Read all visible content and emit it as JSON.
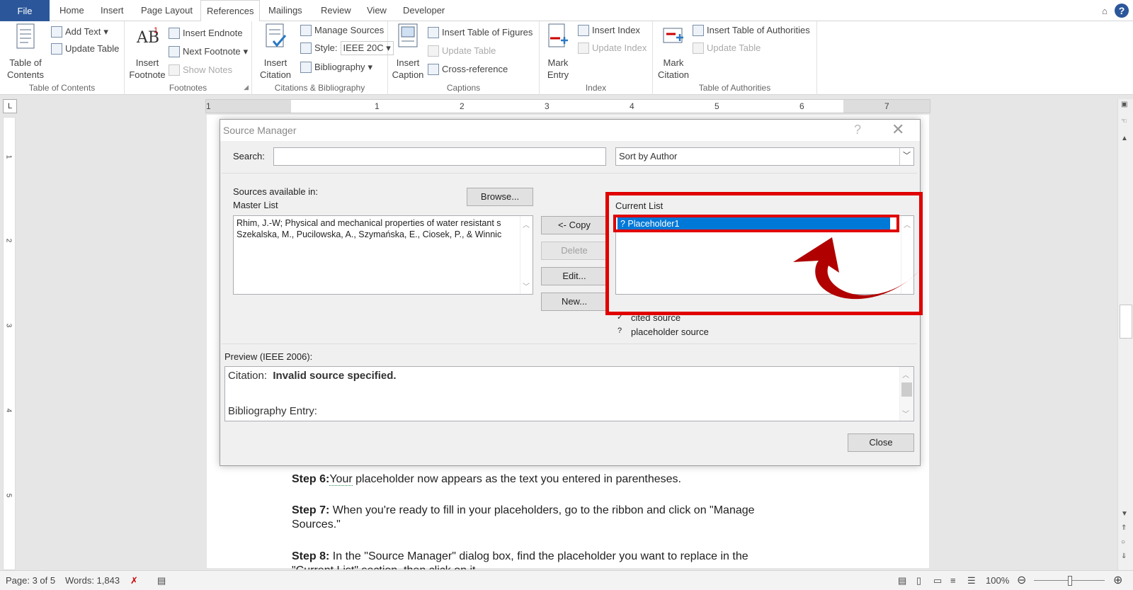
{
  "tabs": {
    "file": "File",
    "items": [
      "Home",
      "Insert",
      "Page Layout",
      "References",
      "Mailings",
      "Review",
      "View",
      "Developer"
    ],
    "active": "References"
  },
  "ribbon": {
    "toc": {
      "big_label": "Table of Contents",
      "add_text": "Add Text",
      "update_table": "Update Table",
      "group": "Table of Contents"
    },
    "footnotes": {
      "big_label": "Insert Footnote",
      "insert_endnote": "Insert Endnote",
      "next_footnote": "Next Footnote",
      "show_notes": "Show Notes",
      "group": "Footnotes"
    },
    "citations": {
      "big_label": "Insert Citation",
      "manage_sources": "Manage Sources",
      "style_label": "Style:",
      "style_value": "IEEE 20C",
      "bibliography": "Bibliography",
      "group": "Citations & Bibliography"
    },
    "captions": {
      "big_label": "Insert Caption",
      "insert_tof": "Insert Table of Figures",
      "update_table": "Update Table",
      "cross_ref": "Cross-reference",
      "group": "Captions"
    },
    "index": {
      "big_label": "Mark Entry",
      "insert_index": "Insert Index",
      "update_index": "Update Index",
      "group": "Index"
    },
    "authorities": {
      "big_label": "Mark Citation",
      "insert_toa": "Insert Table of Authorities",
      "update_table": "Update Table",
      "group": "Table of Authorities"
    }
  },
  "ruler": {
    "corner": "L",
    "h_numbers": [
      "1",
      "1",
      "2",
      "3",
      "4",
      "5",
      "6",
      "7"
    ],
    "v_numbers": [
      "1",
      "2",
      "3",
      "4",
      "5"
    ]
  },
  "dialog": {
    "title": "Source Manager",
    "help": "?",
    "close_x": "✕",
    "search_label": "Search:",
    "search_value": "",
    "sort_value": "Sort by Author",
    "sources_label": "Sources available in:",
    "master_list_label": "Master List",
    "browse": "Browse...",
    "master_items": [
      "Rhim, J.-W; Physical and mechanical properties of water resistant s",
      "Szekalska, M., Pucilowska, A., Szymańska, E., Ciosek, P., & Winnic"
    ],
    "copy": "<- Copy",
    "delete": "Delete",
    "edit": "Edit...",
    "new": "New...",
    "current_list_label": "Current List",
    "current_items": [
      "? Placeholder1"
    ],
    "legend": [
      {
        "mark": "✓",
        "text": "cited source"
      },
      {
        "mark": "?",
        "text": "placeholder source"
      }
    ],
    "preview_label": "Preview (IEEE 2006):",
    "citation_prefix": "Citation:",
    "citation_text": "Invalid source specified.",
    "bibliography_label": "Bibliography Entry:",
    "close": "Close"
  },
  "document": {
    "step6_label": "Step 6:",
    "step6_word": "Your",
    "step6_rest": " placeholder now appears as the text you entered in parentheses.",
    "step7_label": "Step 7:",
    "step7_line1": " When you're ready to fill in your placeholders, go to the ribbon and click on \"Manage",
    "step7_line2": "Sources.\"",
    "step8_label": "Step 8:",
    "step8_line1": " In the \"Source Manager\" dialog box, find the placeholder you want to replace in the",
    "step8_line2": "\"Current List\" section, then click on it."
  },
  "status": {
    "page": "Page: 3 of 5",
    "words": "Words: 1,843",
    "zoom": "100%"
  },
  "colors": {
    "file_tab": "#2b579a",
    "selection": "#0078d7",
    "annotation": "#e00000"
  }
}
